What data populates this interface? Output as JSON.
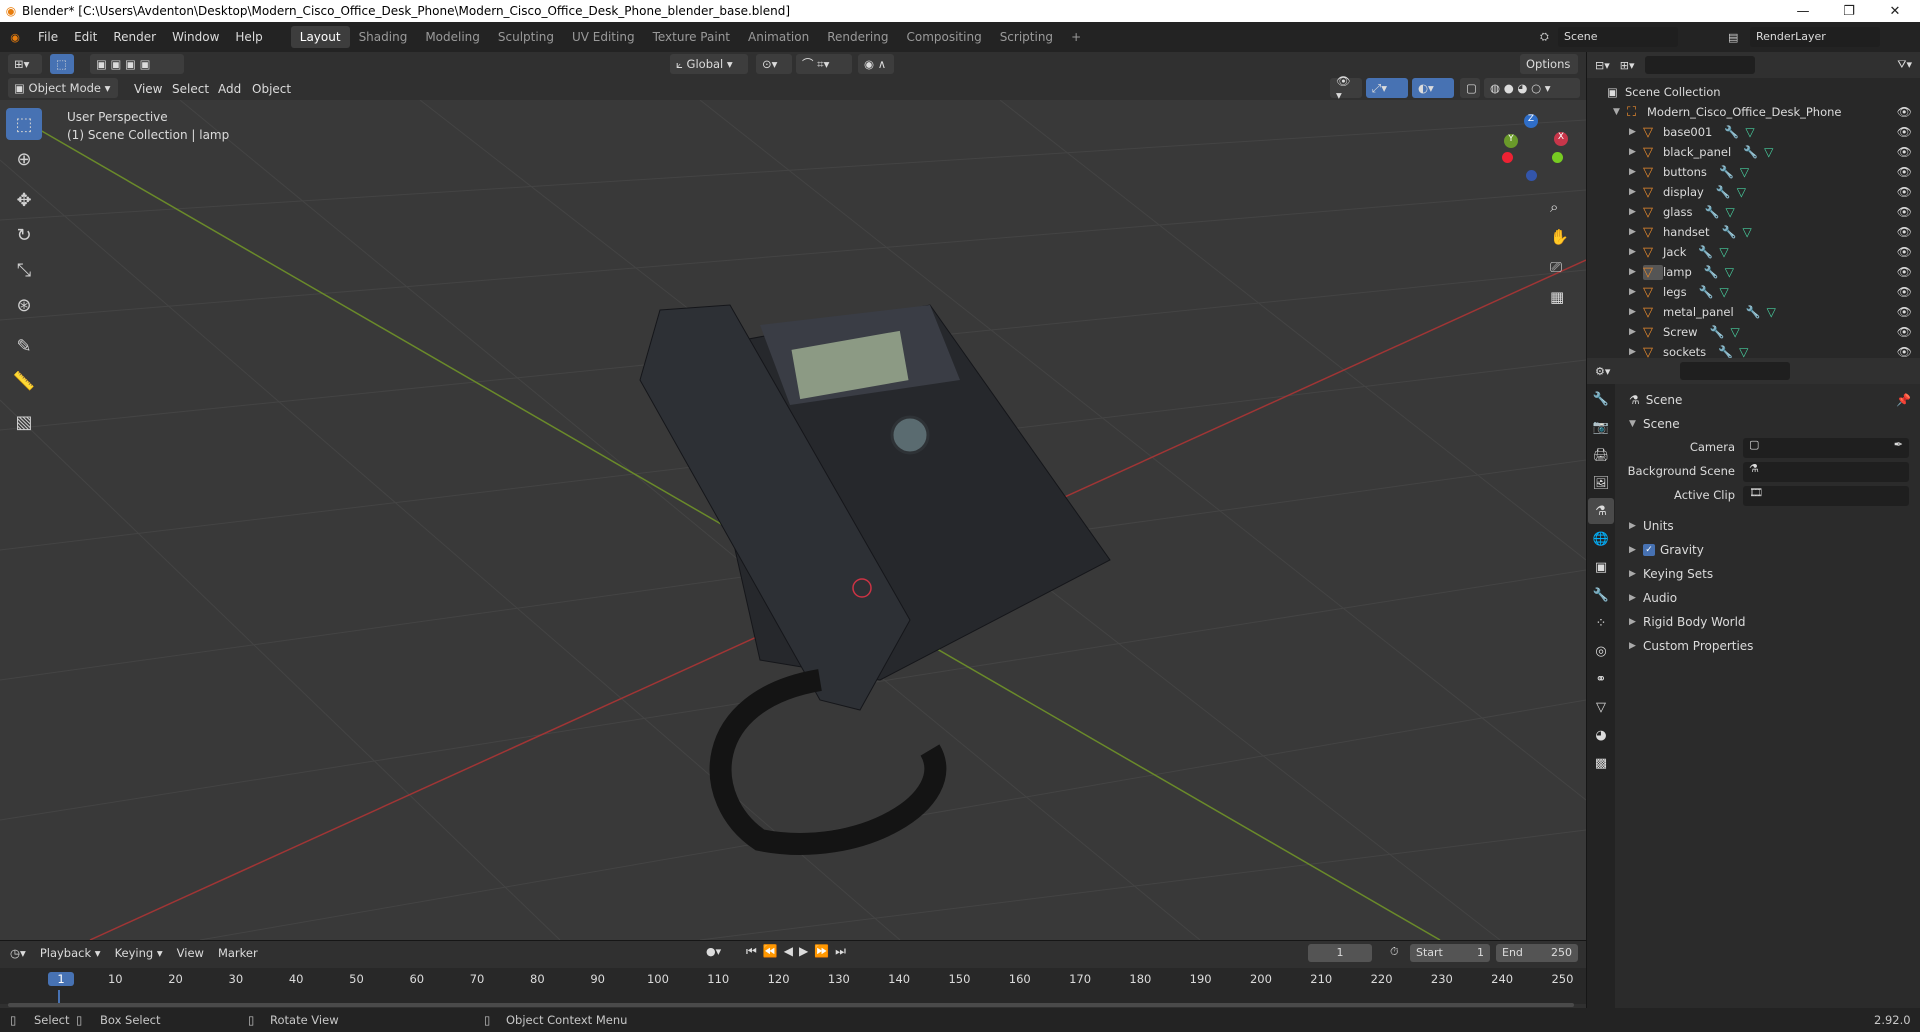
{
  "title": "Blender* [C:\\Users\\Avdenton\\Desktop\\Modern_Cisco_Office_Desk_Phone\\Modern_Cisco_Office_Desk_Phone_blender_base.blend]",
  "menu": [
    "File",
    "Edit",
    "Render",
    "Window",
    "Help"
  ],
  "workspaces": [
    "Layout",
    "Shading",
    "Modeling",
    "Sculpting",
    "UV Editing",
    "Texture Paint",
    "Animation",
    "Rendering",
    "Compositing",
    "Scripting"
  ],
  "scene_name": "Scene",
  "render_layer": "RenderLayer",
  "vp": {
    "mode": "Object Mode",
    "view": "View",
    "select": "Select",
    "add": "Add",
    "object": "Object",
    "transform": "Global",
    "options": "Options",
    "info_line1": "User Perspective",
    "info_line2": "(1) Scene Collection | lamp"
  },
  "outliner": {
    "root": "Scene Collection",
    "collection": "Modern_Cisco_Office_Desk_Phone",
    "items": [
      "base001",
      "black_panel",
      "buttons",
      "display",
      "glass",
      "handset",
      "Jack",
      "lamp",
      "legs",
      "metal_panel",
      "Screw",
      "sockets"
    ]
  },
  "props": {
    "breadcrumb": "Scene",
    "section": "Scene",
    "camera_label": "Camera",
    "bg_label": "Background Scene",
    "clip_label": "Active Clip",
    "panels": [
      "Units",
      "Gravity",
      "Keying Sets",
      "Audio",
      "Rigid Body World",
      "Custom Properties"
    ]
  },
  "timeline": {
    "playback": "Playback",
    "keying": "Keying",
    "view": "View",
    "marker": "Marker",
    "frame": "1",
    "start_label": "Start",
    "start": "1",
    "end_label": "End",
    "end": "250",
    "ticks": [
      "1",
      "10",
      "20",
      "30",
      "40",
      "50",
      "60",
      "70",
      "80",
      "90",
      "100",
      "110",
      "120",
      "130",
      "140",
      "150",
      "160",
      "170",
      "180",
      "190",
      "200",
      "210",
      "220",
      "230",
      "240",
      "250"
    ]
  },
  "status": {
    "select": "Select",
    "box_select": "Box Select",
    "rotate": "Rotate View",
    "context": "Object Context Menu",
    "version": "2.92.0"
  }
}
